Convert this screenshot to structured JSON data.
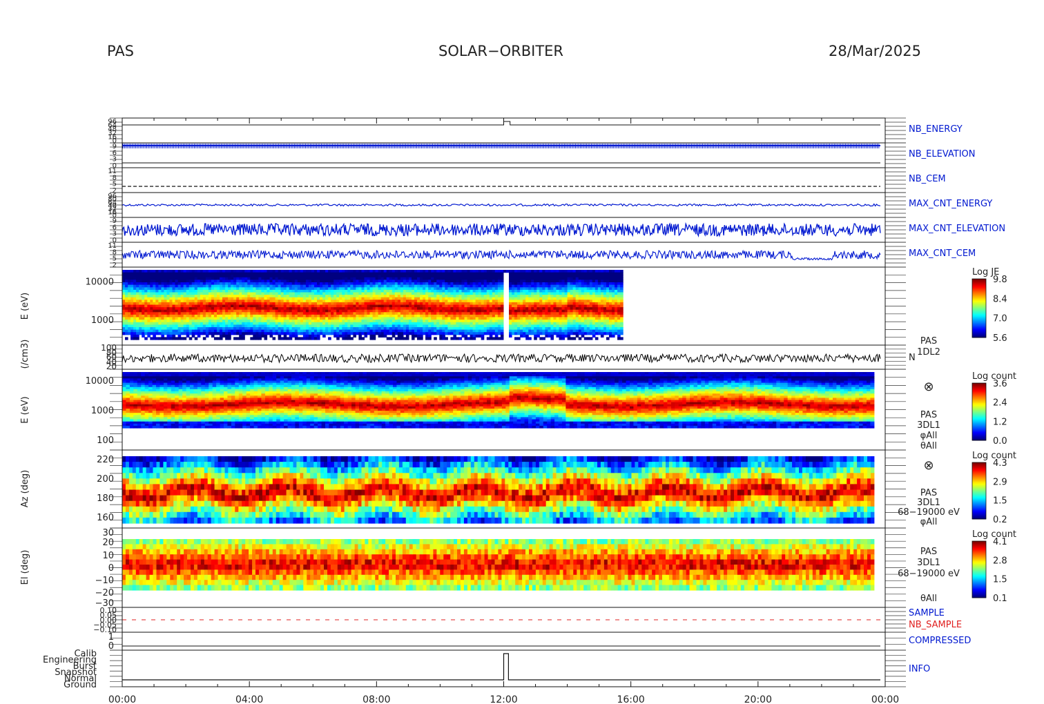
{
  "header": {
    "instrument": "PAS",
    "mission": "SOLAR−ORBITER",
    "date": "28/Mar/2025"
  },
  "colors": {
    "hk_blue": "#0018d0",
    "red_label": "#e02020",
    "density_line": "#000000"
  },
  "chart_data": {
    "type": "heatmap",
    "x": {
      "ticks": [
        "00:00",
        "04:00",
        "08:00",
        "12:00",
        "16:00",
        "20:00",
        "00:00"
      ],
      "range_hours": [
        0,
        24
      ]
    },
    "panels": [
      {
        "id": "nb_energy",
        "label": "NB_ENERGY",
        "tick_labels": [
          "96",
          "64",
          "48",
          "32",
          "16",
          "0"
        ]
      },
      {
        "id": "nb_elevation",
        "label": "NB_ELEVATION",
        "tick_labels": [
          "9",
          "6",
          "3",
          "0"
        ]
      },
      {
        "id": "nb_cem",
        "label": "NB_CEM",
        "tick_labels": [
          "11",
          "8",
          "5",
          "2"
        ]
      },
      {
        "id": "max_cnt_energy",
        "label": "MAX_CNT_ENERGY",
        "tick_labels": [
          "96",
          "80",
          "64",
          "48",
          "32",
          "16",
          "0"
        ]
      },
      {
        "id": "max_cnt_elevation",
        "label": "MAX_CNT_ELEVATION",
        "tick_labels": [
          "9",
          "6",
          "3",
          "0"
        ]
      },
      {
        "id": "max_cnt_cem",
        "label": "MAX_CNT_CEM",
        "tick_labels": [
          "11",
          "8",
          "5",
          "2"
        ]
      },
      {
        "id": "spec_1dl2",
        "ylabel": "E (eV)",
        "ytick_labels": [
          "10000",
          "1000"
        ],
        "ylog_range": [
          300,
          20000
        ],
        "colorbar": {
          "title": "Log JE",
          "ticks": [
            "9.8",
            "8.4",
            "7.0",
            "5.6"
          ]
        },
        "data_end_hour": 15.75
      },
      {
        "id": "density",
        "ylabel": "(/cm3)",
        "label": "N",
        "source": [
          "PAS",
          "1DL2"
        ],
        "ytick_labels": [
          "100",
          "80",
          "60",
          "40",
          "20"
        ]
      },
      {
        "id": "spec_3dl1_energy",
        "ylabel": "E (eV)",
        "ytick_labels": [
          "10000",
          "1000",
          "100"
        ],
        "annot": [
          "PAS",
          "3DL1",
          "φAll",
          "θAll"
        ],
        "colorbar": {
          "title": "Log count",
          "ticks": [
            "3.6",
            "2.4",
            "1.2",
            "0.0"
          ]
        }
      },
      {
        "id": "azimuth",
        "ylabel": "Az (deg)",
        "ytick_labels": [
          "220",
          "200",
          "180",
          "160"
        ],
        "yrange": [
          155,
          225
        ],
        "annot": [
          "PAS",
          "3DL1",
          "68−19000 eV",
          "φAll"
        ],
        "colorbar": {
          "title": "Log count",
          "ticks": [
            "4.3",
            "2.9",
            "1.5",
            "0.2"
          ]
        }
      },
      {
        "id": "elevation",
        "ylabel": "El (deg)",
        "ytick_labels": [
          "30",
          "20",
          "10",
          "0",
          "−10",
          "−20",
          "−30"
        ],
        "yrange": [
          -30,
          30
        ],
        "annot": [
          "PAS",
          "3DL1",
          "68−19000 eV",
          "θAll"
        ],
        "colorbar": {
          "title": "Log count",
          "ticks": [
            "4.1",
            "2.8",
            "1.5",
            "0.1"
          ]
        }
      },
      {
        "id": "sample",
        "labels": [
          "SAMPLE",
          "NB_SAMPLE"
        ],
        "tick_labels": [
          "0.10",
          "0.05",
          "0.00",
          "−0.05",
          "−0.10"
        ]
      },
      {
        "id": "compressed",
        "label": "COMPRESSED",
        "tick_labels": [
          "1",
          "0"
        ]
      },
      {
        "id": "info",
        "label": "INFO",
        "tick_labels": [
          "Calib",
          "Engineering",
          "Burst",
          "Snapshot",
          "Normal",
          "Ground"
        ]
      }
    ]
  }
}
